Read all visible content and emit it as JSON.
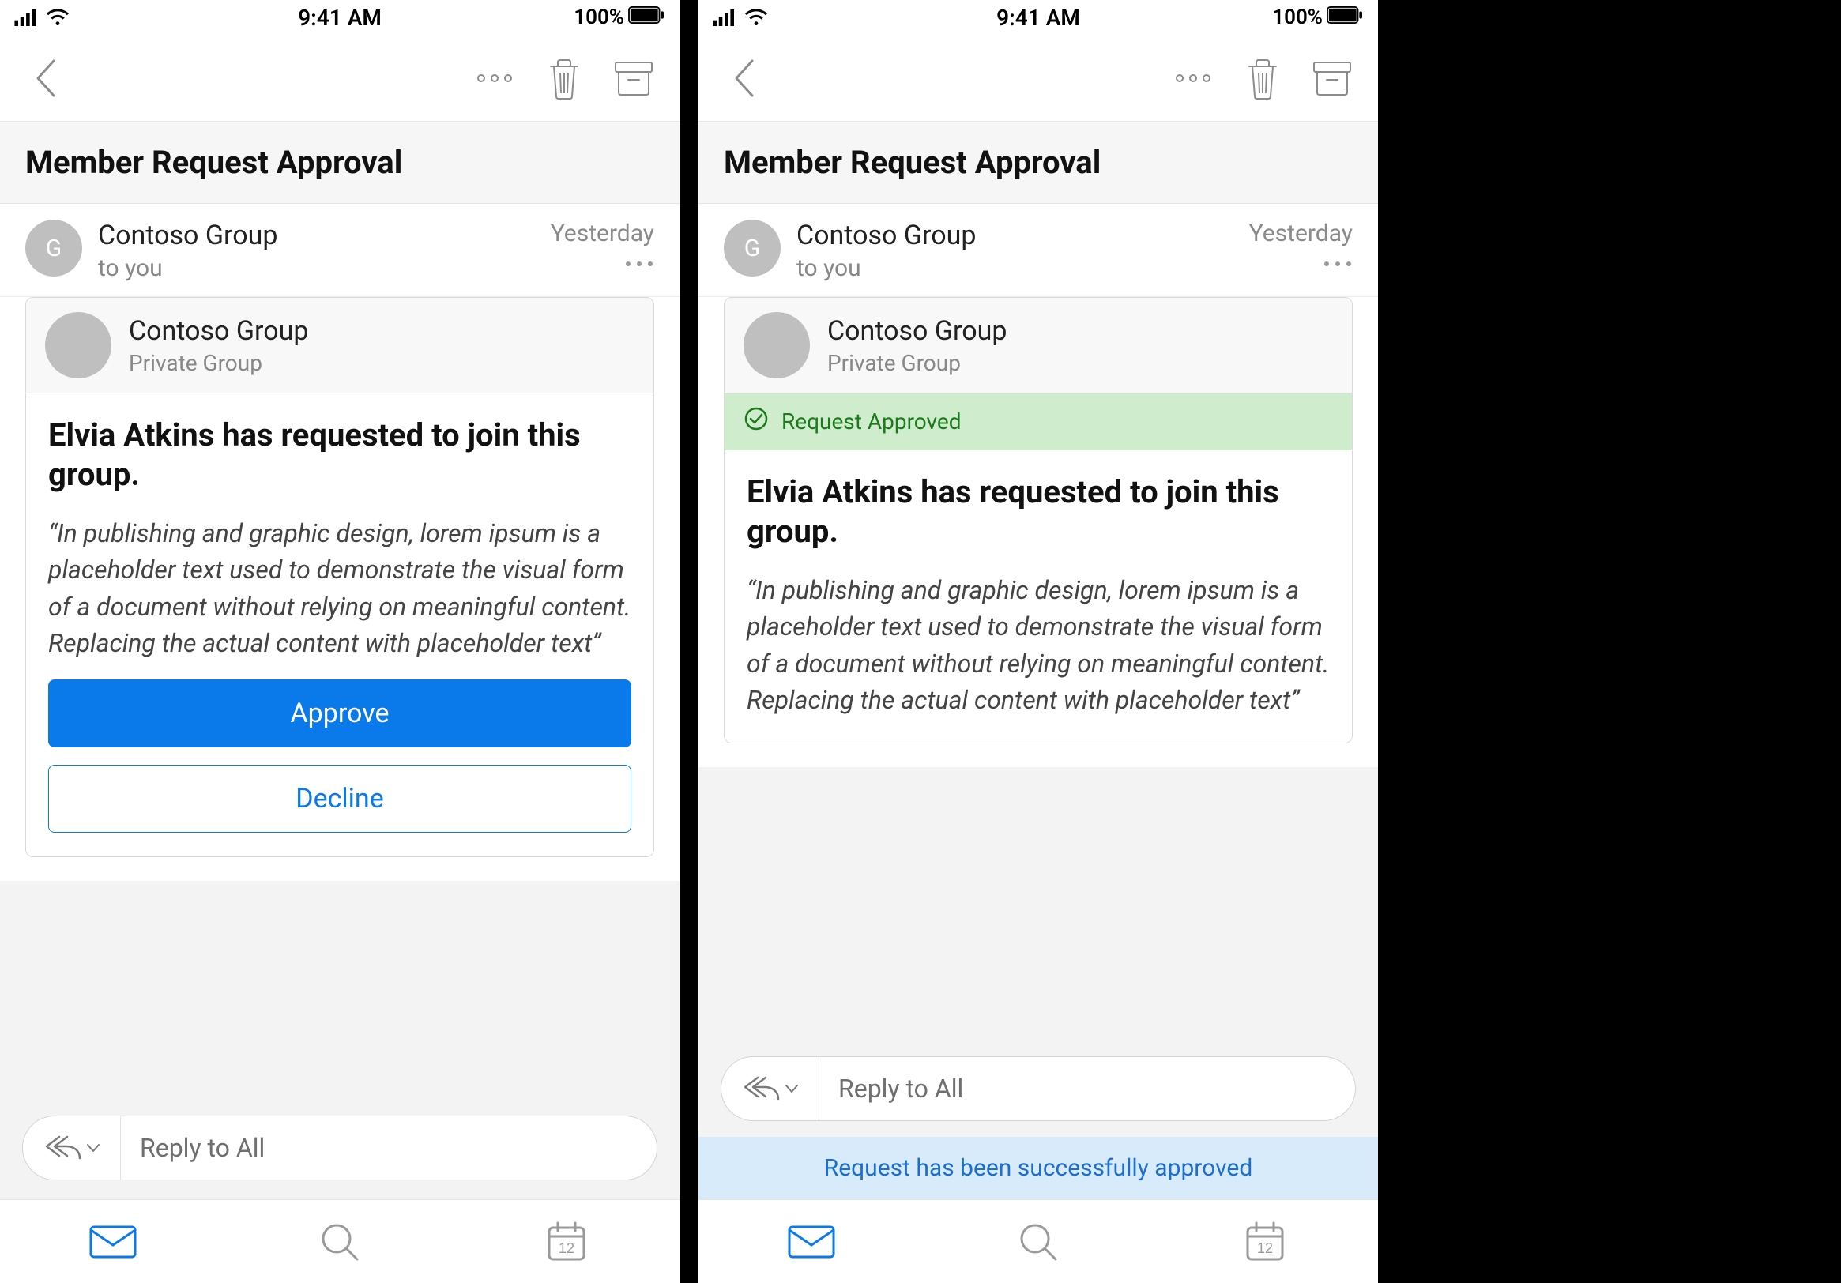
{
  "status": {
    "time": "9:41 AM",
    "battery": "100%"
  },
  "subject": "Member Request Approval",
  "sender": {
    "avatar_initial": "G",
    "name": "Contoso Group",
    "to": "to you",
    "date": "Yesterday"
  },
  "group": {
    "name": "Contoso Group",
    "subtitle": "Private Group"
  },
  "request": {
    "title": "Elvia Atkins has requested to join this group.",
    "quote": "“In publishing and graphic design, lorem ipsum is a placeholder text used to demonstrate the visual form of a document without relying on meaningful content. Replacing the actual content with placeholder text”"
  },
  "buttons": {
    "approve": "Approve",
    "decline": "Decline"
  },
  "approved_strip": "Request Approved",
  "reply": {
    "placeholder": "Reply to All"
  },
  "toast": "Request has been successfully approved",
  "icons": {
    "back": "back-chevron",
    "more": "more-horizontal",
    "delete": "trash",
    "archive": "archive",
    "replyall": "reply-all",
    "chevdown": "chevron-down",
    "mail": "mail",
    "search": "search",
    "calendar": "calendar-12"
  }
}
